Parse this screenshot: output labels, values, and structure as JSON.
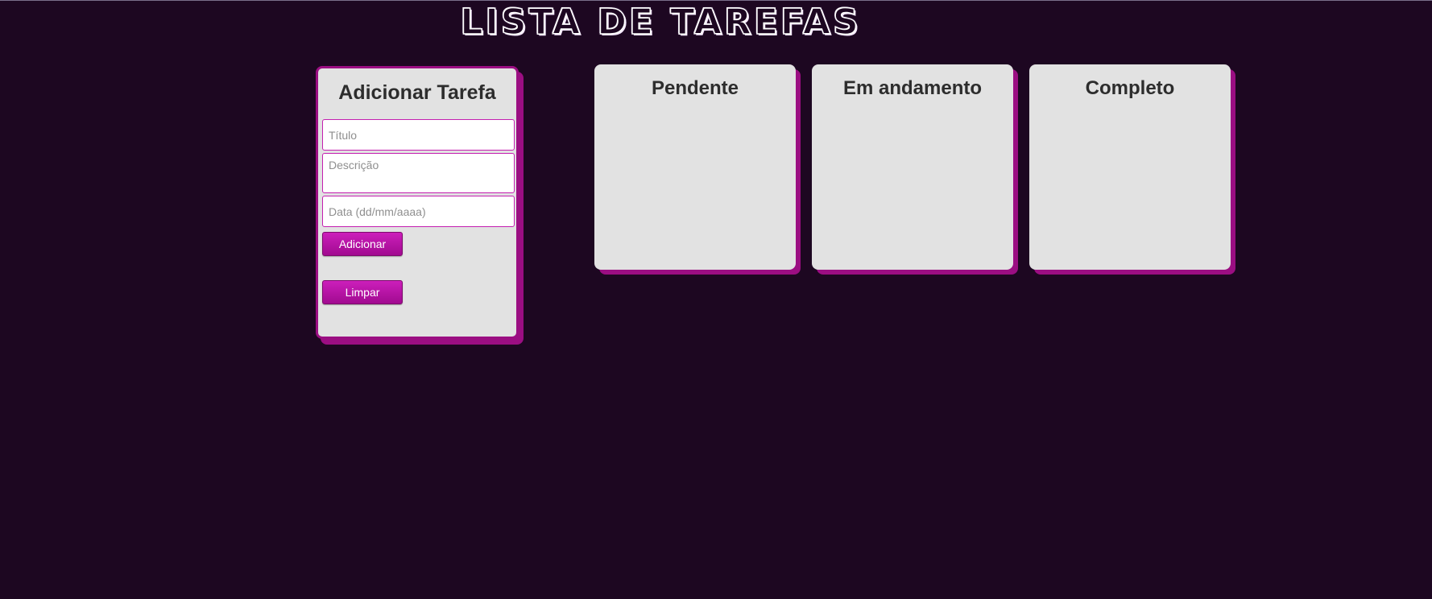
{
  "app": {
    "title": "LISTA DE TAREFAS"
  },
  "form": {
    "title": "Adicionar Tarefa",
    "title_placeholder": "Título",
    "description_placeholder": "Descrição",
    "date_placeholder": "Data (dd/mm/aaaa)",
    "add_button_label": "Adicionar",
    "clear_button_label": "Limpar"
  },
  "columns": [
    {
      "title": "Pendente",
      "tasks": []
    },
    {
      "title": "Em andamento",
      "tasks": []
    },
    {
      "title": "Completo",
      "tasks": []
    }
  ],
  "colors": {
    "background": "#1d0721",
    "accent": "#9b0e82",
    "button": "#c41fb0",
    "panel": "#e2e2e2"
  }
}
